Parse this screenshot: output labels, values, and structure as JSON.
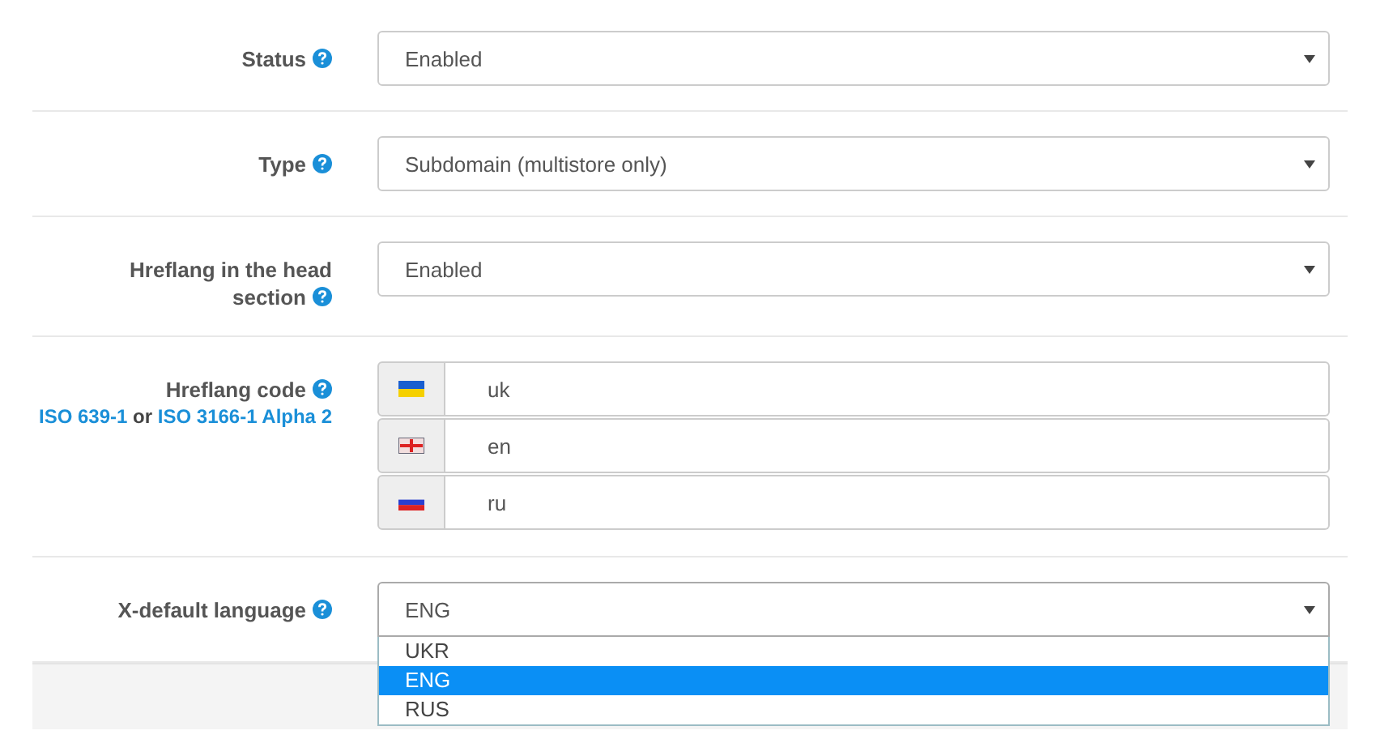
{
  "fields": [
    {
      "kind": "select",
      "label": "Status",
      "value": "Enabled"
    },
    {
      "kind": "select",
      "label": "Type",
      "value": "Subdomain (multistore only)"
    },
    {
      "kind": "select",
      "label": "Hreflang in the head section",
      "value": "Enabled"
    },
    {
      "kind": "flag-inputs",
      "label": "Hreflang code",
      "hint": [
        {
          "kind": "link",
          "text": "ISO 639-1"
        },
        {
          "kind": "text",
          "text": "or"
        },
        {
          "kind": "link",
          "text": "ISO 3166-1 Alpha 2"
        }
      ],
      "inputs": [
        {
          "kind": "ua",
          "value": "uk"
        },
        {
          "kind": "gb",
          "value": "en"
        },
        {
          "kind": "ru",
          "value": "ru"
        }
      ]
    },
    {
      "kind": "select",
      "label": "X-default language",
      "value": "ENG",
      "open": true,
      "options": [
        {
          "label": "UKR",
          "selected": false
        },
        {
          "label": "ENG",
          "selected": true
        },
        {
          "label": "RUS",
          "selected": false
        }
      ]
    }
  ]
}
